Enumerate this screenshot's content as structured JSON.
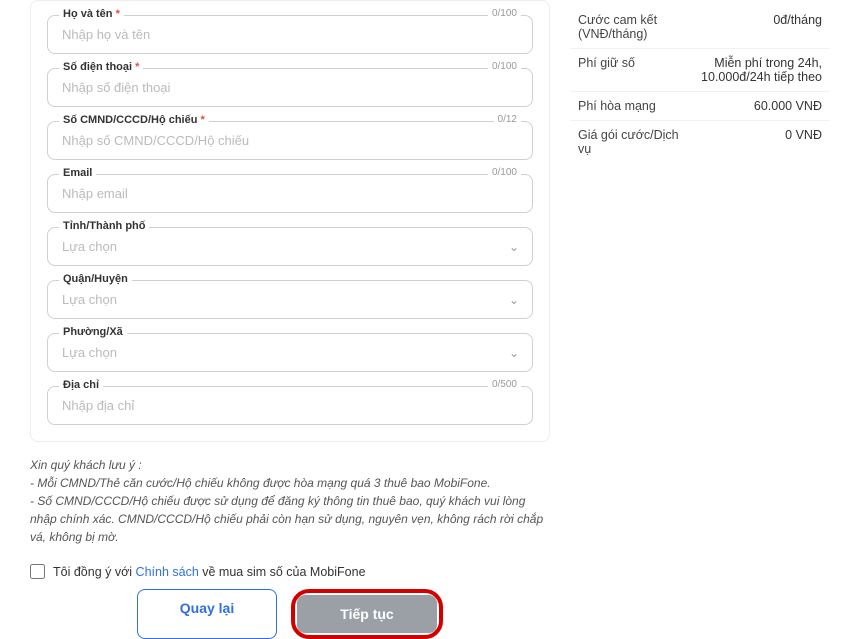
{
  "form": {
    "fullname": {
      "label": "Họ và tên",
      "required": true,
      "placeholder": "Nhập họ và tên",
      "counter": "0/100"
    },
    "phone": {
      "label": "Số điện thoại",
      "required": true,
      "placeholder": "Nhập số điện thoại",
      "counter": "0/100"
    },
    "idnum": {
      "label": "Số CMND/CCCD/Hộ chiếu",
      "required": true,
      "placeholder": "Nhập số CMND/CCCD/Hộ chiếu",
      "counter": "0/12"
    },
    "email": {
      "label": "Email",
      "required": false,
      "placeholder": "Nhập email",
      "counter": "0/100"
    },
    "province": {
      "label": "Tỉnh/Thành phố",
      "placeholder": "Lựa chọn"
    },
    "district": {
      "label": "Quận/Huyện",
      "placeholder": "Lựa chọn"
    },
    "ward": {
      "label": "Phường/Xã",
      "placeholder": "Lựa chọn"
    },
    "address": {
      "label": "Địa chỉ",
      "required": false,
      "placeholder": "Nhập địa chỉ",
      "counter": "0/500"
    }
  },
  "notes": {
    "heading": "Xin quý khách lưu ý :",
    "line1": "- Mỗi CMND/Thẻ căn cước/Hộ chiếu không được hòa mạng quá 3 thuê bao MobiFone.",
    "line2": "- Số CMND/CCCD/Hộ chiếu được sử dụng để đăng ký thông tin thuê bao, quý khách vui lòng nhập chính xác. CMND/CCCD/Hộ chiếu phải còn hạn sử dụng, nguyên vẹn, không rách rời chắp vá, không bị mờ."
  },
  "agree": {
    "prefix": "Tôi đồng ý với ",
    "policy": "Chính sách",
    "suffix": " về mua sim số của MobiFone"
  },
  "buttons": {
    "back": "Quay lại",
    "next": "Tiếp tục"
  },
  "summary": {
    "commit": {
      "label": "Cước cam kết (VNĐ/tháng)",
      "value": "0đ/tháng"
    },
    "holdfee": {
      "label": "Phí giữ số",
      "value": "Miễn phí trong 24h, 10.000đ/24h tiếp theo"
    },
    "actfee": {
      "label": "Phí hòa mạng",
      "value": "60.000 VNĐ"
    },
    "pkgfee": {
      "label": "Giá gói cước/Dịch vụ",
      "value": "0 VNĐ"
    }
  },
  "required_marker": "*"
}
